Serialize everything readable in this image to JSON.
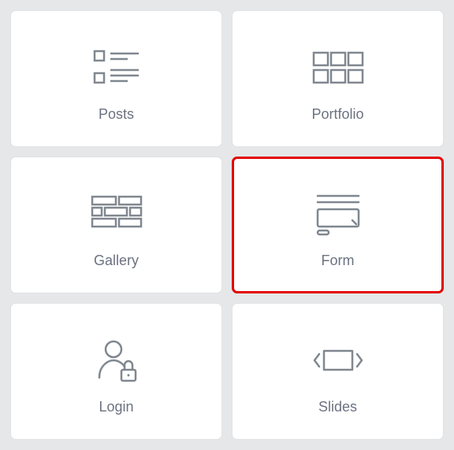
{
  "items": [
    {
      "key": "posts",
      "label": "Posts",
      "icon": "posts-icon",
      "selected": false
    },
    {
      "key": "portfolio",
      "label": "Portfolio",
      "icon": "portfolio-icon",
      "selected": false
    },
    {
      "key": "gallery",
      "label": "Gallery",
      "icon": "gallery-icon",
      "selected": false
    },
    {
      "key": "form",
      "label": "Form",
      "icon": "form-icon",
      "selected": true
    },
    {
      "key": "login",
      "label": "Login",
      "icon": "login-icon",
      "selected": false
    },
    {
      "key": "slides",
      "label": "Slides",
      "icon": "slides-icon",
      "selected": false
    }
  ],
  "colors": {
    "accent": "#e30000",
    "icon": "#808790",
    "label": "#6b7280"
  }
}
